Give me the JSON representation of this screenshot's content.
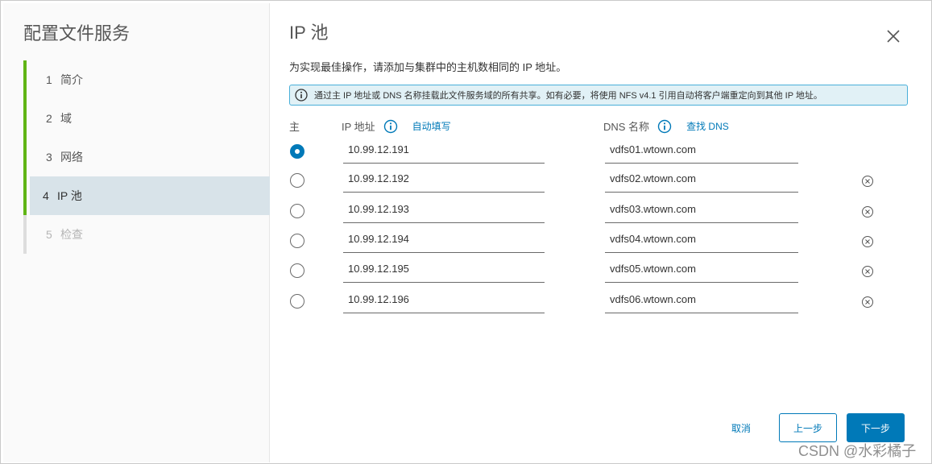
{
  "wizard": {
    "title": "配置文件服务",
    "steps": [
      {
        "num": "1",
        "label": "简介"
      },
      {
        "num": "2",
        "label": "域"
      },
      {
        "num": "3",
        "label": "网络"
      },
      {
        "num": "4",
        "label": "IP 池"
      },
      {
        "num": "5",
        "label": "检查"
      }
    ]
  },
  "page": {
    "title": "IP 池",
    "description": "为实现最佳操作，请添加与集群中的主机数相同的 IP 地址。",
    "info_banner": "通过主 IP 地址或 DNS 名称挂载此文件服务域的所有共享。如有必要，将使用 NFS v4.1 引用自动将客户端重定向到其他 IP 地址。"
  },
  "table": {
    "primary_header": "主",
    "ip_header": "IP 地址",
    "autofill_link": "自动填写",
    "dns_header": "DNS 名称",
    "lookup_link": "查找 DNS",
    "rows": [
      {
        "ip": "10.99.12.191",
        "dns": "vdfs01.wtown.com"
      },
      {
        "ip": "10.99.12.192",
        "dns": "vdfs02.wtown.com"
      },
      {
        "ip": "10.99.12.193",
        "dns": "vdfs03.wtown.com"
      },
      {
        "ip": "10.99.12.194",
        "dns": "vdfs04.wtown.com"
      },
      {
        "ip": "10.99.12.195",
        "dns": "vdfs05.wtown.com"
      },
      {
        "ip": "10.99.12.196",
        "dns": "vdfs06.wtown.com"
      }
    ],
    "primary_selected_index": 0
  },
  "footer": {
    "cancel": "取消",
    "back": "上一步",
    "next": "下一步"
  },
  "watermark": "CSDN @水彩橘子",
  "colors": {
    "accent": "#0079b8",
    "step_complete": "#60b515",
    "active_step_bg": "#d8e3e9",
    "info_bg": "#e1f1f6"
  }
}
